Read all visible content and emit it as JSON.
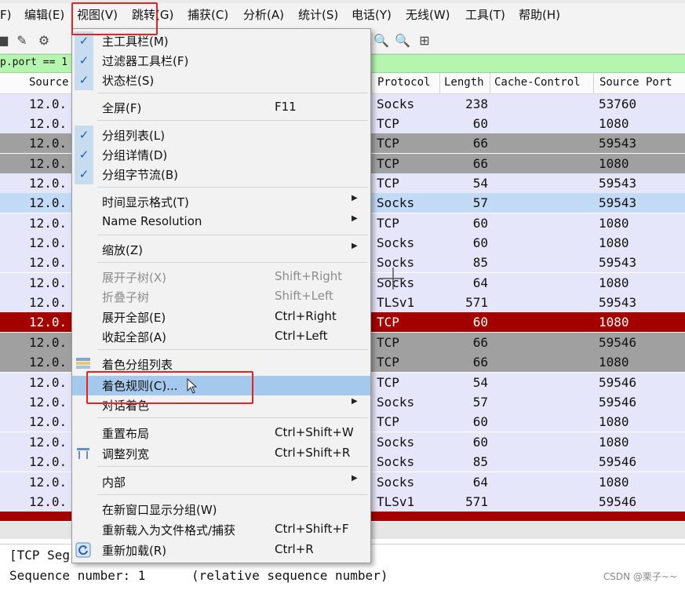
{
  "menubar": {
    "items": [
      "F)",
      "编辑(E)",
      "视图(V)",
      "跳转(G)",
      "捕获(C)",
      "分析(A)",
      "统计(S)",
      "电话(Y)",
      "无线(W)",
      "工具(T)",
      "帮助(H)"
    ]
  },
  "filter": {
    "text": "p.port == 1"
  },
  "columns": {
    "source": "Source",
    "protocol": "Protocol",
    "length": "Length",
    "cache_control": "Cache-Control",
    "source_port": "Source Port"
  },
  "rows": [
    {
      "source": "12.0.",
      "protocol": "Socks",
      "length": "238",
      "port": "53760",
      "color": "#e6e6fa"
    },
    {
      "source": "12.0.",
      "protocol": "TCP",
      "length": "60",
      "port": "1080",
      "color": "#e6e6fa"
    },
    {
      "source": "12.0.",
      "protocol": "TCP",
      "length": "66",
      "port": "59543",
      "color": "#a0a0a0"
    },
    {
      "source": "12.0.",
      "protocol": "TCP",
      "length": "66",
      "port": "1080",
      "color": "#a0a0a0"
    },
    {
      "source": "12.0.",
      "protocol": "TCP",
      "length": "54",
      "port": "59543",
      "color": "#e6e6fa"
    },
    {
      "source": "12.0.",
      "protocol": "Socks",
      "length": "57",
      "port": "59543",
      "color": "#c2daf6"
    },
    {
      "source": "12.0.",
      "protocol": "TCP",
      "length": "60",
      "port": "1080",
      "color": "#e6e6fa"
    },
    {
      "source": "12.0.",
      "protocol": "Socks",
      "length": "60",
      "port": "1080",
      "color": "#e6e6fa"
    },
    {
      "source": "12.0.",
      "protocol": "Socks",
      "length": "85",
      "port": "59543",
      "color": "#e6e6fa"
    },
    {
      "source": "12.0.",
      "protocol": "Socks",
      "length": "64",
      "port": "1080",
      "color": "#e6e6fa"
    },
    {
      "source": "12.0.",
      "protocol": "TLSv1",
      "length": "571",
      "port": "59543",
      "color": "#e6e6fa"
    },
    {
      "source": "12.0.",
      "protocol": "TCP",
      "length": "60",
      "port": "1080",
      "color": "#a40000"
    },
    {
      "source": "12.0.",
      "protocol": "TCP",
      "length": "66",
      "port": "59546",
      "color": "#a0a0a0"
    },
    {
      "source": "12.0.",
      "protocol": "TCP",
      "length": "66",
      "port": "1080",
      "color": "#a0a0a0"
    },
    {
      "source": "12.0.",
      "protocol": "TCP",
      "length": "54",
      "port": "59546",
      "color": "#e6e6fa"
    },
    {
      "source": "12.0.",
      "protocol": "Socks",
      "length": "57",
      "port": "59546",
      "color": "#e6e6fa"
    },
    {
      "source": "12.0.",
      "protocol": "TCP",
      "length": "60",
      "port": "1080",
      "color": "#e6e6fa"
    },
    {
      "source": "12.0.",
      "protocol": "Socks",
      "length": "60",
      "port": "1080",
      "color": "#e6e6fa"
    },
    {
      "source": "12.0.",
      "protocol": "Socks",
      "length": "85",
      "port": "59546",
      "color": "#e6e6fa"
    },
    {
      "source": "12.0.",
      "protocol": "Socks",
      "length": "64",
      "port": "1080",
      "color": "#e6e6fa"
    },
    {
      "source": "12.0.",
      "protocol": "TLSv1",
      "length": "571",
      "port": "59546",
      "color": "#e6e6fa"
    }
  ],
  "menu": {
    "main_toolbar": "主工具栏(M)",
    "filter_toolbar": "过滤器工具栏(F)",
    "status_bar": "状态栏(S)",
    "fullscreen": "全屏(F)",
    "fullscreen_sc": "F11",
    "packet_list": "分组列表(L)",
    "packet_details": "分组详情(D)",
    "packet_bytes": "分组字节流(B)",
    "time_format": "时间显示格式(T)",
    "name_resolution": "Name Resolution",
    "zoom": "缩放(Z)",
    "expand_subtrees": "展开子树(X)",
    "expand_subtrees_sc": "Shift+Right",
    "collapse_subtrees": "折叠子树",
    "collapse_subtrees_sc": "Shift+Left",
    "expand_all": "展开全部(E)",
    "expand_all_sc": "Ctrl+Right",
    "collapse_all": "收起全部(A)",
    "collapse_all_sc": "Ctrl+Left",
    "colorize": "着色分组列表",
    "coloring_rules": "着色规则(C)...",
    "colorize_conversation": "对话着色",
    "reset_layout": "重置布局",
    "reset_layout_sc": "Ctrl+Shift+W",
    "resize_columns": "调整列宽",
    "resize_columns_sc": "Ctrl+Shift+R",
    "internals": "内部",
    "show_new_window": "在新窗口显示分组(W)",
    "reload_as_format": "重新载入为文件格式/捕获",
    "reload_as_format_sc": "Ctrl+Shift+F",
    "reload": "重新加载(R)",
    "reload_sc": "Ctrl+R"
  },
  "detail": {
    "line1": "[TCP Seg",
    "line2_a": "Sequence number: 1",
    "line2_b": "(relative sequence number)"
  },
  "watermark": "CSDN @栗子~~"
}
